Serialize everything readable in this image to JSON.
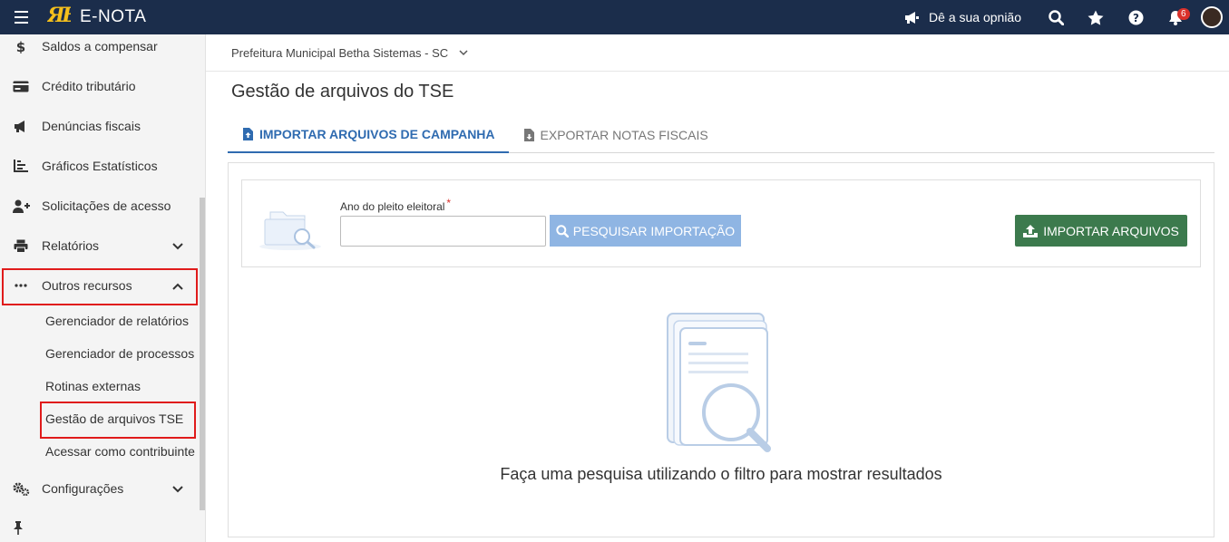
{
  "header": {
    "app_title": "E-NOTA",
    "logo_text": "B",
    "opinion_label": "Dê a sua opnião",
    "notification_count": "6"
  },
  "sidebar": {
    "items": [
      {
        "label": "Saldos a compensar",
        "icon": "dollar-icon"
      },
      {
        "label": "Crédito tributário",
        "icon": "credit-card-icon"
      },
      {
        "label": "Denúncias fiscais",
        "icon": "megaphone-icon"
      },
      {
        "label": "Gráficos Estatísticos",
        "icon": "chart-icon"
      },
      {
        "label": "Solicitações de acesso",
        "icon": "user-plus-icon"
      },
      {
        "label": "Relatórios",
        "icon": "printer-icon"
      },
      {
        "label": "Outros recursos",
        "icon": "ellipsis-icon"
      },
      {
        "label": "Configurações",
        "icon": "gears-icon"
      }
    ],
    "sub_items": [
      {
        "label": "Gerenciador de relatórios"
      },
      {
        "label": "Gerenciador de processos"
      },
      {
        "label": "Rotinas externas"
      },
      {
        "label": "Gestão de arquivos TSE"
      },
      {
        "label": "Acessar como contribuinte"
      }
    ]
  },
  "breadcrumb": {
    "entity": "Prefeitura Municipal Betha Sistemas - SC"
  },
  "main": {
    "title": "Gestão de arquivos do TSE",
    "tabs": [
      {
        "label": "IMPORTAR ARQUIVOS DE CAMPANHA",
        "active": true
      },
      {
        "label": "EXPORTAR NOTAS FISCAIS",
        "active": false
      }
    ],
    "filter": {
      "year_label": "Ano do pleito eleitoral",
      "required_mark": "*",
      "year_value": "",
      "search_button": "PESQUISAR IMPORTAÇÃO",
      "import_button": "IMPORTAR ARQUIVOS"
    },
    "empty_message": "Faça uma pesquisa utilizando o filtro para mostrar resultados"
  },
  "colors": {
    "topbar": "#1b2d4b",
    "accent": "#2f6bb0",
    "import_button": "#3c7a4d",
    "search_button": "#8fb5e3",
    "highlight": "#e01b1b"
  }
}
